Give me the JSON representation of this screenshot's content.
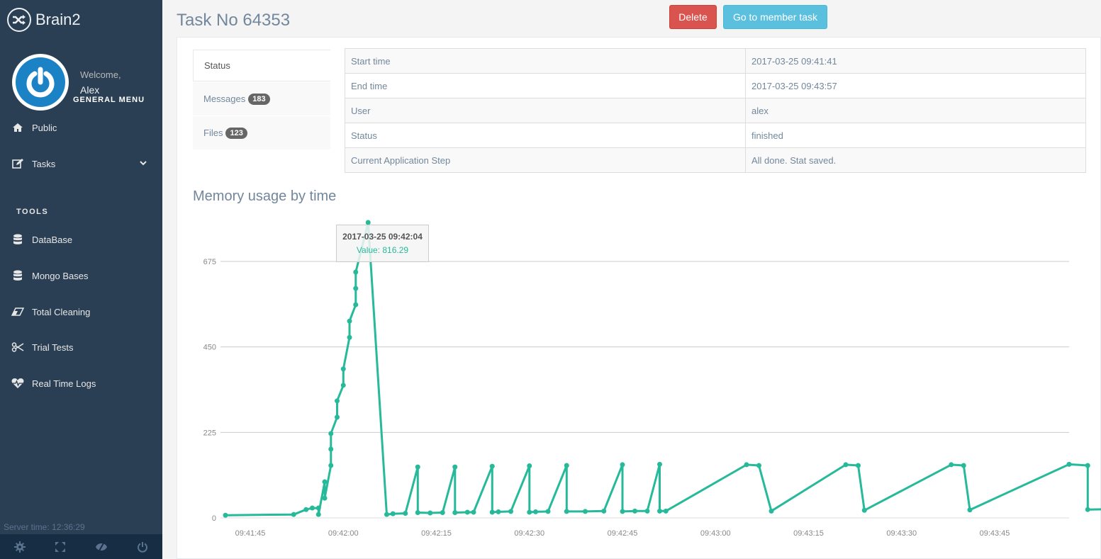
{
  "app": {
    "brand": "Brain2",
    "welcome": "Welcome,",
    "user": "Alex",
    "general_menu": "GENERAL MENU"
  },
  "sidebar": {
    "items": [
      {
        "label": "Public",
        "icon": "home-icon"
      },
      {
        "label": "Tasks",
        "icon": "edit-icon",
        "has_submenu": true
      }
    ],
    "tools_title": "TOOLS",
    "tools": [
      {
        "label": "DataBase",
        "icon": "database-icon"
      },
      {
        "label": "Mongo Bases",
        "icon": "database-icon"
      },
      {
        "label": "Total Cleaning",
        "icon": "eraser-icon"
      },
      {
        "label": "Trial Tests",
        "icon": "scissors-icon"
      },
      {
        "label": "Real Time Logs",
        "icon": "heartbeat-icon"
      }
    ],
    "server_time": "Server time: 12:36:29",
    "footer_icons": [
      "settings-icon",
      "fullscreen-icon",
      "lock-eye-icon",
      "logout-icon"
    ]
  },
  "header": {
    "title": "Task No 64353",
    "delete_label": "Delete",
    "member_label": "Go to member task"
  },
  "tabs": [
    {
      "label": "Status",
      "active": true
    },
    {
      "label": "Messages",
      "badge": "183"
    },
    {
      "label": "Files",
      "badge": "123"
    }
  ],
  "info": [
    {
      "key": "Start time",
      "value": "2017-03-25 09:41:41"
    },
    {
      "key": "End time",
      "value": "2017-03-25 09:43:57"
    },
    {
      "key": "User",
      "value": "alex"
    },
    {
      "key": "Status",
      "value": "finished"
    },
    {
      "key": "Current Application Step",
      "value": "All done. Stat saved."
    }
  ],
  "colors": {
    "line": "#26b99a",
    "sidebar": "#2a3f54",
    "delete": "#d9534f",
    "info_btn": "#5bc0de"
  },
  "chart_data": {
    "type": "line",
    "title": "Memory usage by time",
    "xlabel": "",
    "ylabel": "",
    "x_unit": "seconds since 09:41:41",
    "ylim": [
      0,
      816.29
    ],
    "yticks": [
      0,
      225,
      450,
      675
    ],
    "xticks": [
      {
        "t": 4,
        "label": "09:41:45"
      },
      {
        "t": 19,
        "label": "09:42:00"
      },
      {
        "t": 34,
        "label": "09:42:15"
      },
      {
        "t": 49,
        "label": "09:42:30"
      },
      {
        "t": 64,
        "label": "09:42:45"
      },
      {
        "t": 79,
        "label": "09:43:00"
      },
      {
        "t": 94,
        "label": "09:43:15"
      },
      {
        "t": 109,
        "label": "09:43:30"
      },
      {
        "t": 124,
        "label": "09:43:45"
      }
    ],
    "grid": true,
    "tooltip": {
      "title": "2017-03-25 09:42:04",
      "value_label": "Value: 816.29"
    },
    "series": [
      {
        "name": "Value",
        "points": [
          [
            0,
            7
          ],
          [
            11,
            9
          ],
          [
            13,
            22
          ],
          [
            14,
            26
          ],
          [
            15,
            26
          ],
          [
            15,
            9
          ],
          [
            16,
            95
          ],
          [
            16,
            52
          ],
          [
            17,
            138
          ],
          [
            17,
            181
          ],
          [
            17,
            222
          ],
          [
            18,
            265
          ],
          [
            18,
            308
          ],
          [
            19,
            349
          ],
          [
            19,
            392
          ],
          [
            20,
            475
          ],
          [
            20,
            518
          ],
          [
            21,
            561
          ],
          [
            21,
            604
          ],
          [
            21,
            647
          ],
          [
            23,
            816.29
          ],
          [
            26,
            9
          ],
          [
            27,
            11
          ],
          [
            29,
            12
          ],
          [
            31,
            134
          ],
          [
            31,
            14
          ],
          [
            33,
            13
          ],
          [
            35,
            14
          ],
          [
            37,
            134
          ],
          [
            37,
            14
          ],
          [
            39,
            15
          ],
          [
            40,
            15
          ],
          [
            43,
            136
          ],
          [
            43,
            15
          ],
          [
            44,
            16
          ],
          [
            46,
            17
          ],
          [
            49,
            137
          ],
          [
            49,
            15
          ],
          [
            50,
            16
          ],
          [
            52,
            17
          ],
          [
            55,
            138
          ],
          [
            55,
            17
          ],
          [
            58,
            17
          ],
          [
            61,
            18
          ],
          [
            64,
            140
          ],
          [
            64,
            17
          ],
          [
            66,
            18
          ],
          [
            68,
            18
          ],
          [
            70,
            141
          ],
          [
            70,
            18
          ],
          [
            71,
            18
          ],
          [
            84,
            140
          ],
          [
            86,
            138
          ],
          [
            88,
            18
          ],
          [
            100,
            140
          ],
          [
            102,
            138
          ],
          [
            103,
            20
          ],
          [
            117,
            140
          ],
          [
            119,
            138
          ],
          [
            120,
            21
          ],
          [
            136,
            141
          ],
          [
            139,
            138
          ],
          [
            139,
            22
          ],
          [
            148,
            24
          ]
        ]
      }
    ]
  }
}
